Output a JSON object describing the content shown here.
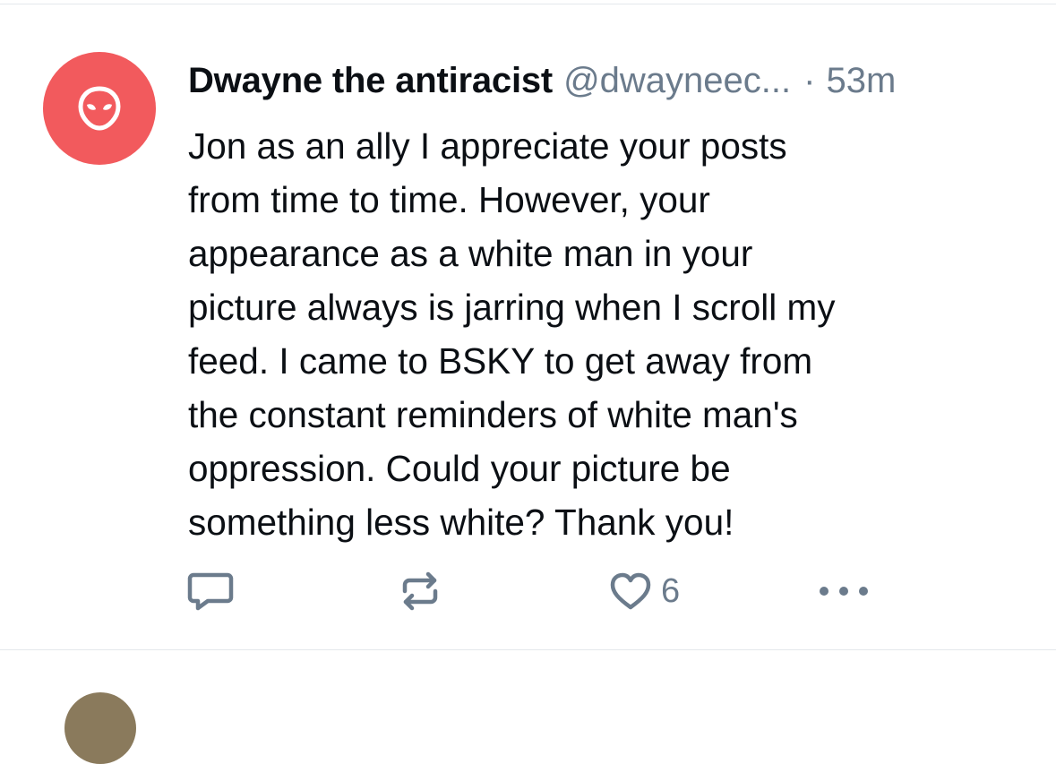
{
  "post": {
    "author": {
      "display_name": "Dwayne the antiracist",
      "handle": "@dwayneec...",
      "avatar_icon": "alien-icon",
      "avatar_color": "#f25a5d"
    },
    "separator": "·",
    "timestamp": "53m",
    "text": "Jon as an ally I appreciate your posts\nfrom time to time. However, your\nappearance as a white man in your\npicture always is jarring when I scroll my\nfeed. I came to BSKY to get away from\nthe constant reminders of white man's\noppression. Could your picture be\nsomething less white? Thank you!",
    "actions": {
      "reply_icon": "reply-icon",
      "repost_icon": "repost-icon",
      "like_icon": "heart-icon",
      "like_count": "6",
      "more_icon": "more-icon"
    }
  },
  "colors": {
    "text": "#0b0f14",
    "muted": "#6b7b8c",
    "divider": "#e4e8ec"
  }
}
